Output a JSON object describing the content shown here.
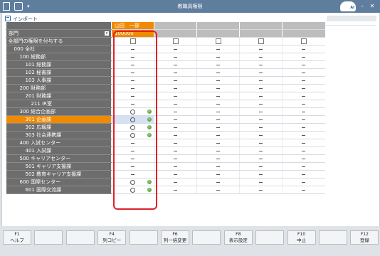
{
  "window": {
    "title": "教職員権限",
    "logo_text": "AI"
  },
  "toolbar": {
    "import_label": "インポート"
  },
  "grid": {
    "user_name": "山田　一部",
    "user_id": "100000",
    "department_header": "部門",
    "grant_all_label": "全部門の権限を付与する",
    "rows": [
      {
        "label": "000 全社",
        "indent": 1,
        "first": "dash",
        "selected": false,
        "ok": false
      },
      {
        "label": "100 総務部",
        "indent": 2,
        "first": "dash",
        "selected": false,
        "ok": false
      },
      {
        "label": "101 総務課",
        "indent": 3,
        "first": "dash",
        "selected": false,
        "ok": false
      },
      {
        "label": "102 秘書課",
        "indent": 3,
        "first": "dash",
        "selected": false,
        "ok": false
      },
      {
        "label": "103 人事課",
        "indent": 3,
        "first": "dash",
        "selected": false,
        "ok": false
      },
      {
        "label": "200 財務部",
        "indent": 2,
        "first": "dash",
        "selected": false,
        "ok": false
      },
      {
        "label": "201 財務課",
        "indent": 3,
        "first": "dash",
        "selected": false,
        "ok": false
      },
      {
        "label": "211 IR室",
        "indent": 4,
        "first": "dash",
        "selected": false,
        "ok": false
      },
      {
        "label": "300 総合企画部",
        "indent": 2,
        "first": "circle",
        "selected": false,
        "ok": true
      },
      {
        "label": "301 企画課",
        "indent": 3,
        "first": "circle",
        "selected": true,
        "ok": true
      },
      {
        "label": "302 広報課",
        "indent": 3,
        "first": "circle",
        "selected": false,
        "ok": true
      },
      {
        "label": "303 社会連携課",
        "indent": 3,
        "first": "circle",
        "selected": false,
        "ok": true
      },
      {
        "label": "400 入試センター",
        "indent": 2,
        "first": "dash",
        "selected": false,
        "ok": false
      },
      {
        "label": "401 入試課",
        "indent": 3,
        "first": "dash",
        "selected": false,
        "ok": false
      },
      {
        "label": "500 キャリアセンター",
        "indent": 2,
        "first": "dash",
        "selected": false,
        "ok": false
      },
      {
        "label": "501 キャリア支援課",
        "indent": 3,
        "first": "dash",
        "selected": false,
        "ok": false
      },
      {
        "label": "502 教育キャリア支援課",
        "indent": 3,
        "first": "dash",
        "selected": false,
        "ok": false
      },
      {
        "label": "600 国際センター",
        "indent": 2,
        "first": "circle",
        "selected": false,
        "ok": true
      },
      {
        "label": "601 国際交流課",
        "indent": 3,
        "first": "circle",
        "selected": false,
        "ok": true
      }
    ]
  },
  "fkeys": [
    {
      "key": "F1",
      "label": "ヘルプ"
    },
    {
      "key": "",
      "label": ""
    },
    {
      "key": "",
      "label": ""
    },
    {
      "key": "F4",
      "label": "列コピー"
    },
    {
      "key": "",
      "label": ""
    },
    {
      "key": "F6",
      "label": "列一括変更"
    },
    {
      "key": "",
      "label": ""
    },
    {
      "key": "F8",
      "label": "表示設定"
    },
    {
      "key": "",
      "label": ""
    },
    {
      "key": "F10",
      "label": "中止"
    },
    {
      "key": "",
      "label": ""
    },
    {
      "key": "F12",
      "label": "登録"
    }
  ],
  "colors": {
    "accent": "#f08a00",
    "highlight": "#e0202a",
    "titlebar": "#5f7e9e",
    "ok": "#6ab04c"
  }
}
